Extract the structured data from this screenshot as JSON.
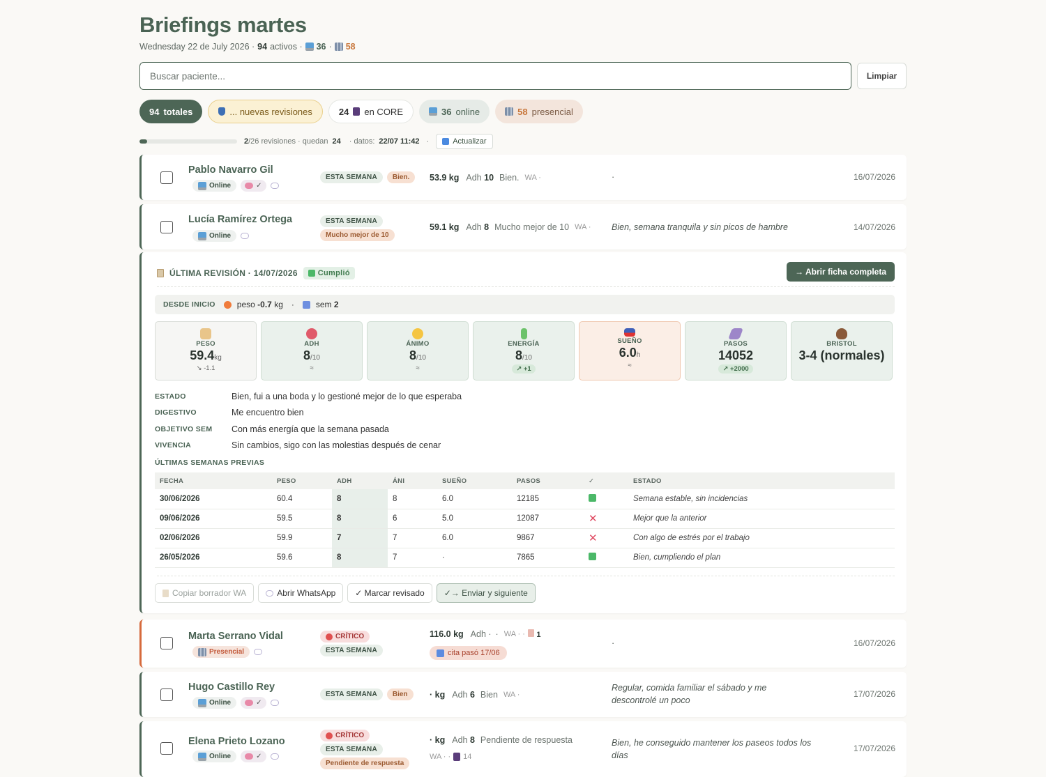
{
  "header": {
    "title": "Briefings martes",
    "date": "Wednesday 22 de July 2026 ·",
    "activos_num": "94",
    "activos_label": "activos ·",
    "online_num": "36",
    "sep": "·",
    "presencial_num": "58"
  },
  "search": {
    "placeholder": "Buscar paciente...",
    "clear_label": "Limpiar"
  },
  "chips": {
    "total_num": "94",
    "total_label": "totales",
    "new_label": "... nuevas revisiones",
    "core_num": "24",
    "core_label": "en CORE",
    "online_num": "36",
    "online_label": "online",
    "pres_num": "58",
    "pres_label": "presencial"
  },
  "progress": {
    "done": "2",
    "text1": "/26 revisiones · quedan",
    "remaining": "24",
    "text2": "· datos:",
    "updated": "22/07 11:42",
    "dot": "·",
    "refresh_label": "Actualizar",
    "fraction": 0.077
  },
  "patients": [
    {
      "name": "Pablo Navarro Gil",
      "mode": "Online",
      "brain": "✓",
      "week": "ESTA SEMANA",
      "mood": "Bien.",
      "peso": "53.9 kg",
      "adh_label": "Adh",
      "adh": "10",
      "estado": "Bien.",
      "wa": "WA ·",
      "note": "·",
      "date": "16/07/2026"
    },
    {
      "name": "Lucía Ramírez Ortega",
      "mode": "Online",
      "week": "ESTA SEMANA",
      "mood": "Mucho mejor de 10",
      "peso": "59.1 kg",
      "adh_label": "Adh",
      "adh": "8",
      "estado": "Mucho mejor de 10",
      "wa": "WA ·",
      "note": "Bien, semana tranquila y sin picos de hambre",
      "date": "14/07/2026"
    },
    {
      "name": "Marta Serrano Vidal",
      "mode": "Presencial",
      "crit": "CRÍTICO",
      "week": "ESTA SEMANA",
      "peso": "116.0 kg",
      "adh_label": "Adh ·",
      "estado": "·",
      "wa": "WA · ·",
      "count": "1",
      "cita": "cita pasó 17/06",
      "note": "·",
      "date": "16/07/2026"
    },
    {
      "name": "Hugo Castillo Rey",
      "mode": "Online",
      "brain": "✓",
      "week": "ESTA SEMANA",
      "mood": "Bien",
      "peso": "· kg",
      "adh_label": "Adh",
      "adh": "6",
      "estado": "Bien",
      "wa": "WA ·",
      "note": "Regular, comida familiar el sábado y me descontrolé un poco",
      "date": "17/07/2026"
    },
    {
      "name": "Elena Prieto Lozano",
      "mode": "Online",
      "brain": "✓",
      "crit": "CRÍTICO",
      "week": "ESTA SEMANA",
      "mood": "Pendiente de respuesta",
      "peso": "· kg",
      "adh_label": "Adh",
      "adh": "8",
      "estado": "Pendiente de respuesta",
      "wa": "WA · ·",
      "count": "14",
      "note": "Bien, he conseguido mantener los paseos todos los días",
      "date": "17/07/2026"
    }
  ],
  "panel": {
    "title": "ÚLTIMA REVISIÓN · 14/07/2026",
    "status": "Cumplió",
    "open_label": "→ Abrir ficha completa",
    "since_label": "DESDE INICIO",
    "peso_label": "peso",
    "peso_delta": "-0.7",
    "peso_unit": "kg",
    "dot": "·",
    "sem_label": "sem",
    "sem": "2",
    "cards": [
      {
        "label": "PESO",
        "value": "59.4",
        "unit": "kg",
        "delta": "↘ -1.1",
        "icon": "scale-icon"
      },
      {
        "label": "ADH",
        "value": "8",
        "unit": "/10",
        "delta": "≈",
        "icon": "target-icon"
      },
      {
        "label": "ÁNIMO",
        "value": "8",
        "unit": "/10",
        "delta": "≈",
        "icon": "smile-icon"
      },
      {
        "label": "ENERGÍA",
        "value": "8",
        "unit": "/10",
        "delta": "↗ +1",
        "icon": "battery-icon"
      },
      {
        "label": "SUEÑO",
        "value": "6.0",
        "unit": "h",
        "delta": "≈",
        "icon": "bed-icon"
      },
      {
        "label": "PASOS",
        "value": "14052",
        "unit": "",
        "delta": "↗ +2000",
        "icon": "shoe-icon"
      },
      {
        "label": "BRISTOL",
        "value": "3-4 (normales)",
        "unit": "",
        "delta": "",
        "icon": "poop-icon"
      }
    ],
    "fields": [
      {
        "label": "ESTADO",
        "value": "Bien, fui a una boda y lo gestioné mejor de lo que esperaba"
      },
      {
        "label": "DIGESTIVO",
        "value": "Me encuentro bien"
      },
      {
        "label": "OBJETIVO SEM",
        "value": "Con más energía que la semana pasada"
      },
      {
        "label": "VIVENCIA",
        "value": "Sin cambios, sigo con las molestias después de cenar"
      }
    ],
    "prev_title": "ÚLTIMAS SEMANAS PREVIAS",
    "table_headers": [
      "FECHA",
      "PESO",
      "ADH",
      "ÁNI",
      "SUEÑO",
      "PASOS",
      "✓",
      "ESTADO"
    ],
    "rows": [
      {
        "fecha": "30/06/2026",
        "peso": "60.4",
        "adh": "8",
        "ani": "8",
        "sueno": "6.0",
        "pasos": "12185",
        "ok": true,
        "estado": "Semana estable, sin incidencias"
      },
      {
        "fecha": "09/06/2026",
        "peso": "59.5",
        "adh": "8",
        "ani": "6",
        "sueno": "5.0",
        "pasos": "12087",
        "ok": false,
        "estado": "Mejor que la anterior"
      },
      {
        "fecha": "02/06/2026",
        "peso": "59.9",
        "adh": "7",
        "ani": "7",
        "sueno": "6.0",
        "pasos": "9867",
        "ok": false,
        "estado": "Con algo de estrés por el trabajo"
      },
      {
        "fecha": "26/05/2026",
        "peso": "59.6",
        "adh": "8",
        "ani": "7",
        "sueno": "·",
        "pasos": "7865",
        "ok": true,
        "estado": "Bien, cumpliendo el plan"
      }
    ],
    "actions": {
      "copy": "Copiar borrador WA",
      "whatsapp": "Abrir WhatsApp",
      "mark": "✓ Marcar revisado",
      "send": "✓→ Enviar y siguiente"
    }
  },
  "colors": {
    "accent": "#4d6656",
    "critical": "#e05050",
    "warm": "#c8773c"
  }
}
